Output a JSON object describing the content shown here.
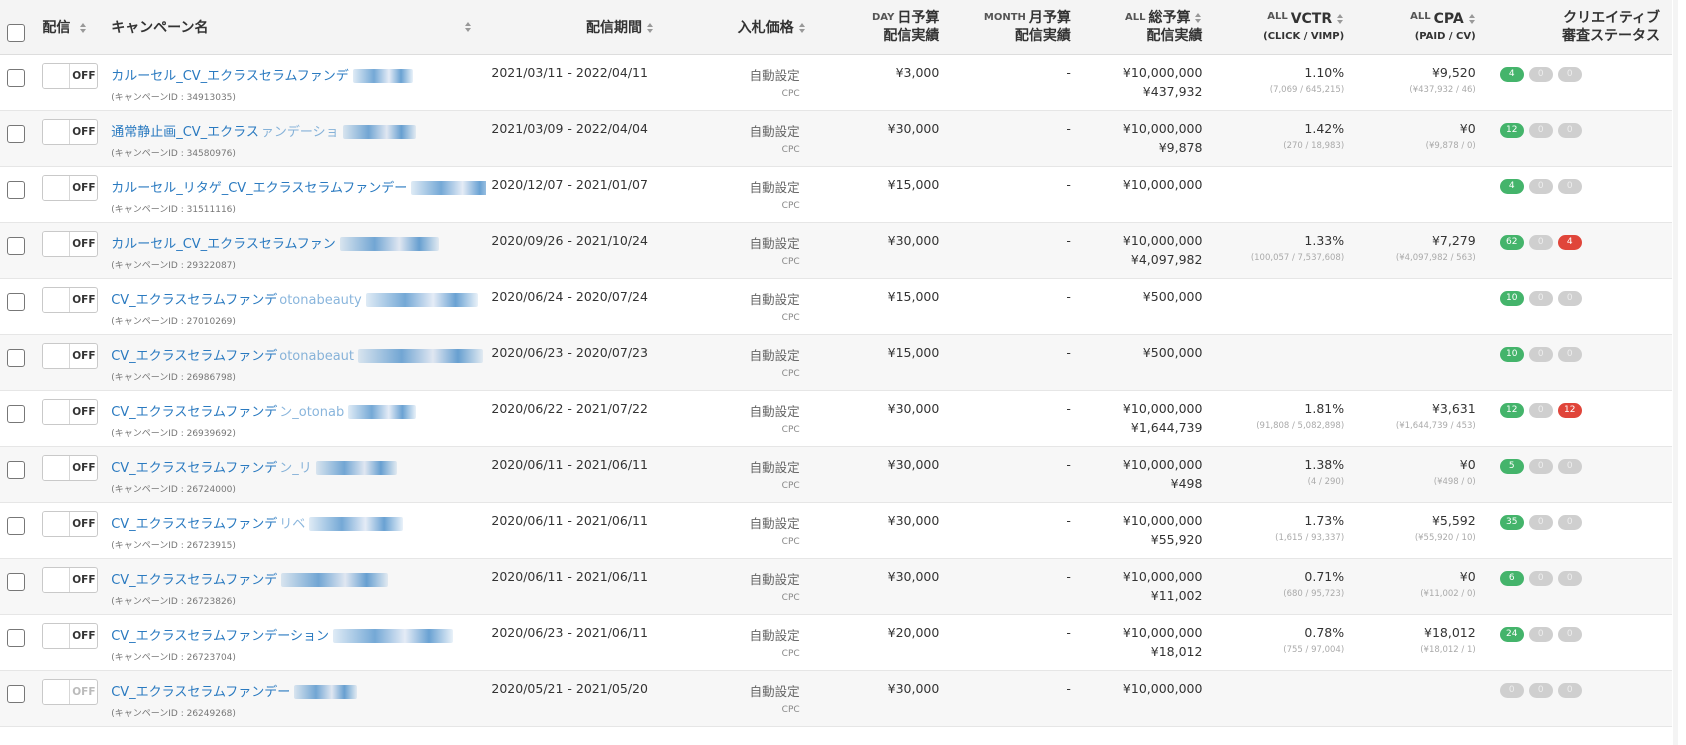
{
  "header": {
    "col_delivery": "配信",
    "col_campaign": "キャンペーン名",
    "col_period": "配信期間",
    "col_bid": "入札価格",
    "day_prefix": "DAY",
    "day_label": "日予算",
    "day_sub": "配信実績",
    "month_prefix": "MONTH",
    "month_label": "月予算",
    "month_sub": "配信実績",
    "total_prefix": "ALL",
    "total_label": "総予算",
    "total_sub": "配信実績",
    "vctr_prefix": "ALL",
    "vctr_label": "VCTR",
    "vctr_sub": "(CLICK / VIMP)",
    "cpa_prefix": "ALL",
    "cpa_label": "CPA",
    "cpa_sub": "(PAID / CV)",
    "creative_label": "クリエイティブ",
    "creative_sub": "審査ステータス"
  },
  "colors": {
    "link": "#2a7ac0",
    "green": "#44b46b",
    "red": "#e0453a",
    "gray": "#cfcfcf"
  },
  "rows": [
    {
      "toggle": "OFF",
      "dim": false,
      "name": "カルーセル_CV_エクラスセラムファンデ",
      "id": "(キャンペーンID : 34913035)",
      "period": "2021/03/11 - 2022/04/11",
      "bid": "自動設定",
      "bid_type": "CPC",
      "day": "¥3,000",
      "month": "-",
      "total": "¥10,000,000",
      "total_result": "¥437,932",
      "vctr": "1.10%",
      "vctr_detail": "(7,069 / 645,215)",
      "cpa": "¥9,520",
      "cpa_detail": "(¥437,932 / 46)",
      "badges": [
        {
          "n": "4",
          "c": "green"
        },
        {
          "n": "0",
          "c": "gray"
        },
        {
          "n": "0",
          "c": "gray"
        }
      ]
    },
    {
      "toggle": "OFF",
      "dim": false,
      "name": "通常静止画_CV_エクラス",
      "name_tail": "ァンデーショ",
      "id": "(キャンペーンID : 34580976)",
      "period": "2021/03/09 - 2022/04/04",
      "bid": "自動設定",
      "bid_type": "CPC",
      "day": "¥30,000",
      "month": "-",
      "total": "¥10,000,000",
      "total_result": "¥9,878",
      "vctr": "1.42%",
      "vctr_detail": "(270 / 18,983)",
      "cpa": "¥0",
      "cpa_detail": "(¥9,878 / 0)",
      "badges": [
        {
          "n": "12",
          "c": "green"
        },
        {
          "n": "0",
          "c": "gray"
        },
        {
          "n": "0",
          "c": "gray"
        }
      ]
    },
    {
      "toggle": "OFF",
      "dim": false,
      "name": "カルーセル_リタゲ_CV_エクラスセラムファンデー",
      "id": "(キャンペーンID : 31511116)",
      "period": "2020/12/07 - 2021/01/07",
      "bid": "自動設定",
      "bid_type": "CPC",
      "day": "¥15,000",
      "month": "-",
      "total": "¥10,000,000",
      "total_result": "",
      "vctr": "",
      "vctr_detail": "",
      "cpa": "",
      "cpa_detail": "",
      "badges": [
        {
          "n": "4",
          "c": "green"
        },
        {
          "n": "0",
          "c": "gray"
        },
        {
          "n": "0",
          "c": "gray"
        }
      ]
    },
    {
      "toggle": "OFF",
      "dim": false,
      "name": "カルーセル_CV_エクラスセラムファン",
      "id": "(キャンペーンID : 29322087)",
      "period": "2020/09/26 - 2021/10/24",
      "bid": "自動設定",
      "bid_type": "CPC",
      "day": "¥30,000",
      "month": "-",
      "total": "¥10,000,000",
      "total_result": "¥4,097,982",
      "vctr": "1.33%",
      "vctr_detail": "(100,057 / 7,537,608)",
      "cpa": "¥7,279",
      "cpa_detail": "(¥4,097,982 / 563)",
      "badges": [
        {
          "n": "62",
          "c": "green"
        },
        {
          "n": "0",
          "c": "gray"
        },
        {
          "n": "4",
          "c": "red"
        }
      ]
    },
    {
      "toggle": "OFF",
      "dim": false,
      "name": "CV_エクラスセラムファンデ",
      "name_tail": "otonabeauty",
      "id": "(キャンペーンID : 27010269)",
      "period": "2020/06/24 - 2020/07/24",
      "bid": "自動設定",
      "bid_type": "CPC",
      "day": "¥15,000",
      "month": "-",
      "total": "¥500,000",
      "total_result": "",
      "vctr": "",
      "vctr_detail": "",
      "cpa": "",
      "cpa_detail": "",
      "badges": [
        {
          "n": "10",
          "c": "green"
        },
        {
          "n": "0",
          "c": "gray"
        },
        {
          "n": "0",
          "c": "gray"
        }
      ]
    },
    {
      "toggle": "OFF",
      "dim": false,
      "name": "CV_エクラスセラムファンデ",
      "name_tail": "otonabeaut",
      "id": "(キャンペーンID : 26986798)",
      "period": "2020/06/23 - 2020/07/23",
      "bid": "自動設定",
      "bid_type": "CPC",
      "day": "¥15,000",
      "month": "-",
      "total": "¥500,000",
      "total_result": "",
      "vctr": "",
      "vctr_detail": "",
      "cpa": "",
      "cpa_detail": "",
      "badges": [
        {
          "n": "10",
          "c": "green"
        },
        {
          "n": "0",
          "c": "gray"
        },
        {
          "n": "0",
          "c": "gray"
        }
      ]
    },
    {
      "toggle": "OFF",
      "dim": false,
      "name": "CV_エクラスセラムファンデ",
      "name_tail": "ン_otonab",
      "id": "(キャンペーンID : 26939692)",
      "period": "2020/06/22 - 2021/07/22",
      "bid": "自動設定",
      "bid_type": "CPC",
      "day": "¥30,000",
      "month": "-",
      "total": "¥10,000,000",
      "total_result": "¥1,644,739",
      "vctr": "1.81%",
      "vctr_detail": "(91,808 / 5,082,898)",
      "cpa": "¥3,631",
      "cpa_detail": "(¥1,644,739 / 453)",
      "badges": [
        {
          "n": "12",
          "c": "green"
        },
        {
          "n": "0",
          "c": "gray"
        },
        {
          "n": "12",
          "c": "red"
        }
      ]
    },
    {
      "toggle": "OFF",
      "dim": false,
      "name": "CV_エクラスセラムファンデ",
      "name_tail": "ン_リ",
      "id": "(キャンペーンID : 26724000)",
      "period": "2020/06/11 - 2021/06/11",
      "bid": "自動設定",
      "bid_type": "CPC",
      "day": "¥30,000",
      "month": "-",
      "total": "¥10,000,000",
      "total_result": "¥498",
      "vctr": "1.38%",
      "vctr_detail": "(4 / 290)",
      "cpa": "¥0",
      "cpa_detail": "(¥498 / 0)",
      "badges": [
        {
          "n": "5",
          "c": "green"
        },
        {
          "n": "0",
          "c": "gray"
        },
        {
          "n": "0",
          "c": "gray"
        }
      ]
    },
    {
      "toggle": "OFF",
      "dim": false,
      "name": "CV_エクラスセラムファンデ",
      "name_tail": "リベ",
      "id": "(キャンペーンID : 26723915)",
      "period": "2020/06/11 - 2021/06/11",
      "bid": "自動設定",
      "bid_type": "CPC",
      "day": "¥30,000",
      "month": "-",
      "total": "¥10,000,000",
      "total_result": "¥55,920",
      "vctr": "1.73%",
      "vctr_detail": "(1,615 / 93,337)",
      "cpa": "¥5,592",
      "cpa_detail": "(¥55,920 / 10)",
      "badges": [
        {
          "n": "35",
          "c": "green"
        },
        {
          "n": "0",
          "c": "gray"
        },
        {
          "n": "0",
          "c": "gray"
        }
      ]
    },
    {
      "toggle": "OFF",
      "dim": false,
      "name": "CV_エクラスセラムファンデ",
      "id": "(キャンペーンID : 26723826)",
      "period": "2020/06/11 - 2021/06/11",
      "bid": "自動設定",
      "bid_type": "CPC",
      "day": "¥30,000",
      "month": "-",
      "total": "¥10,000,000",
      "total_result": "¥11,002",
      "vctr": "0.71%",
      "vctr_detail": "(680 / 95,723)",
      "cpa": "¥0",
      "cpa_detail": "(¥11,002 / 0)",
      "badges": [
        {
          "n": "6",
          "c": "green"
        },
        {
          "n": "0",
          "c": "gray"
        },
        {
          "n": "0",
          "c": "gray"
        }
      ]
    },
    {
      "toggle": "OFF",
      "dim": false,
      "name": "CV_エクラスセラムファンデーション",
      "id": "(キャンペーンID : 26723704)",
      "period": "2020/06/23 - 2021/06/11",
      "bid": "自動設定",
      "bid_type": "CPC",
      "day": "¥20,000",
      "month": "-",
      "total": "¥10,000,000",
      "total_result": "¥18,012",
      "vctr": "0.78%",
      "vctr_detail": "(755 / 97,004)",
      "cpa": "¥18,012",
      "cpa_detail": "(¥18,012 / 1)",
      "badges": [
        {
          "n": "24",
          "c": "green"
        },
        {
          "n": "0",
          "c": "gray"
        },
        {
          "n": "0",
          "c": "gray"
        }
      ]
    },
    {
      "toggle": "OFF",
      "dim": true,
      "name": "CV_エクラスセラムファンデー",
      "id": "(キャンペーンID : 26249268)",
      "period": "2020/05/21 - 2021/05/20",
      "bid": "自動設定",
      "bid_type": "CPC",
      "day": "¥30,000",
      "month": "-",
      "total": "¥10,000,000",
      "total_result": "",
      "vctr": "",
      "vctr_detail": "",
      "cpa": "",
      "cpa_detail": "",
      "badges": [
        {
          "n": "0",
          "c": "gray"
        },
        {
          "n": "0",
          "c": "gray"
        },
        {
          "n": "0",
          "c": "gray"
        }
      ]
    }
  ]
}
